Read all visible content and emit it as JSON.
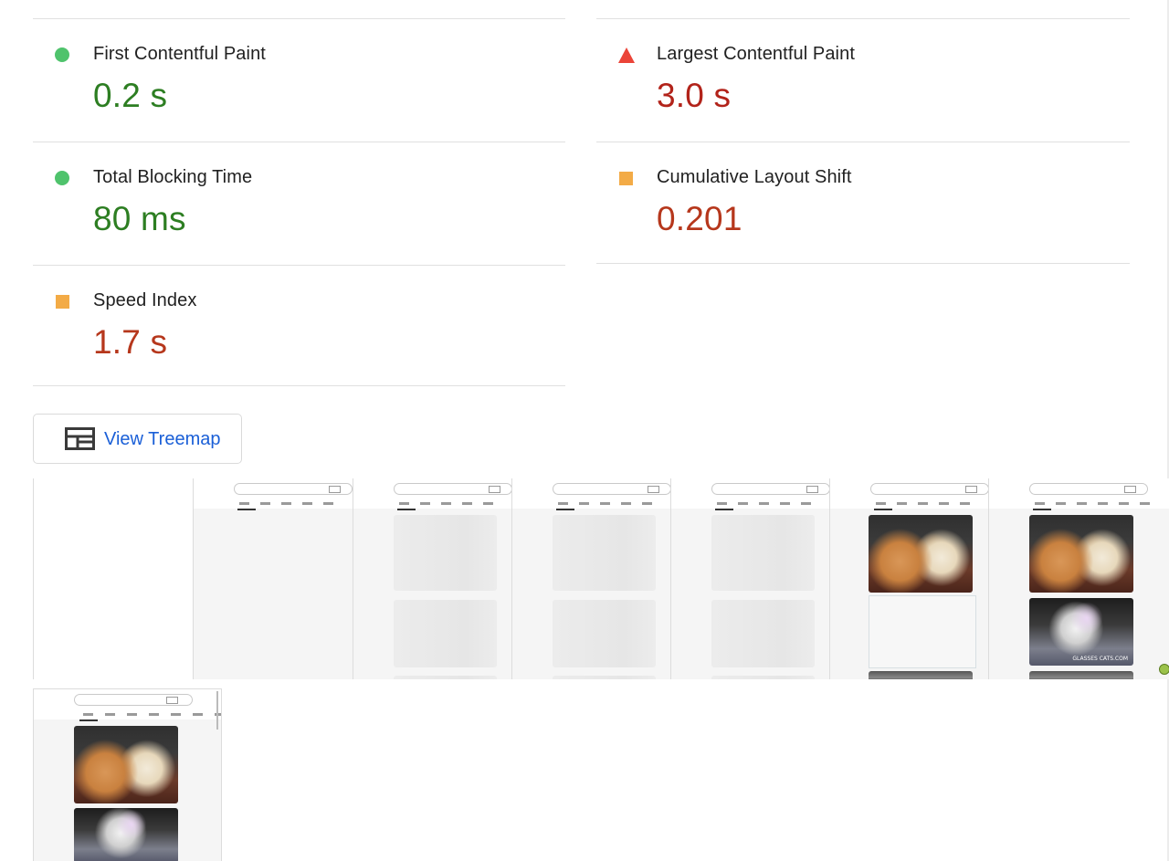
{
  "metrics": [
    {
      "title": "First Contentful Paint",
      "value": "0.2 s",
      "rating": "pass"
    },
    {
      "title": "Largest Contentful Paint",
      "value": "3.0 s",
      "rating": "fail"
    },
    {
      "title": "Total Blocking Time",
      "value": "80 ms",
      "rating": "pass"
    },
    {
      "title": "Cumulative Layout Shift",
      "value": "0.201",
      "rating": "average"
    },
    {
      "title": "Speed Index",
      "value": "1.7 s",
      "rating": "average"
    }
  ],
  "treemap_button": {
    "label": "View Treemap",
    "icon": "treemap-icon"
  },
  "filmstrip": {
    "frame_count": 8,
    "frames": [
      "blank",
      "header-only",
      "placeholders",
      "placeholders",
      "placeholders",
      "first-image",
      "two-images",
      "final"
    ],
    "image_watermark": "GLASSES CATS.COM"
  },
  "colors": {
    "pass": "#2d7e22",
    "average": "#b6371c",
    "fail": "#b2231a",
    "link": "#1a5fd7"
  }
}
